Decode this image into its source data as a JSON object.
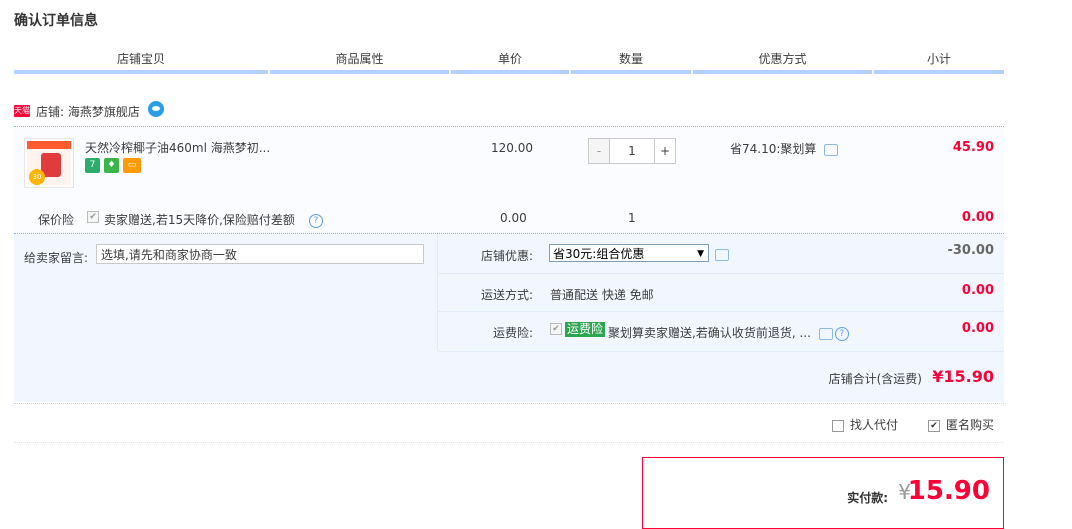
{
  "page_title": "确认订单信息",
  "columns": [
    "店铺宝贝",
    "商品属性",
    "单价",
    "数量",
    "优惠方式",
    "小计"
  ],
  "shop": {
    "badge": "天猫",
    "label": "店铺: 海燕梦旗舰店"
  },
  "item": {
    "thumb_badge": "30",
    "title": "天然冷榨椰子油460ml 海燕梦初...",
    "service_icons": [
      "7-days-return-icon",
      "guarantee-icon",
      "card-pay-icon"
    ],
    "price": "120.00",
    "quantity": {
      "minus": "-",
      "value": "1",
      "plus": "+"
    },
    "promotion": "省74.10:聚划算",
    "subtotal": "45.90"
  },
  "insurance": {
    "label": "保价险",
    "text": "卖家赠送,若15天降价,保险赔付差额",
    "help": "?",
    "price": "0.00",
    "quantity": "1",
    "subtotal": "0.00"
  },
  "message": {
    "label": "给卖家留言:",
    "placeholder": "选填,请先和商家协商一致"
  },
  "shop_discount": {
    "label": "店铺优惠:",
    "selected": "省30元:组合优惠",
    "value": "-30.00"
  },
  "shipping": {
    "label": "运送方式:",
    "text": "普通配送 快递 免邮",
    "value": "0.00"
  },
  "freight_insurance": {
    "label": "运费险:",
    "tag": "运费险",
    "text": "聚划算卖家赠送,若确认收货前退货, ...",
    "value": "0.00"
  },
  "shop_total": {
    "label": "店铺合计(含运费)",
    "value": "¥15.90"
  },
  "options": {
    "proxy_pay": "找人代付",
    "anonymous": "匿名购买"
  },
  "payment": {
    "label": "实付款:",
    "currency": "¥",
    "amount": "15.90"
  },
  "colors": {
    "accent_red": "#ff0036",
    "header_border": "#b2d1ff",
    "extra_bg": "#f2f7ff",
    "freight_tag": "#2ca64e"
  }
}
